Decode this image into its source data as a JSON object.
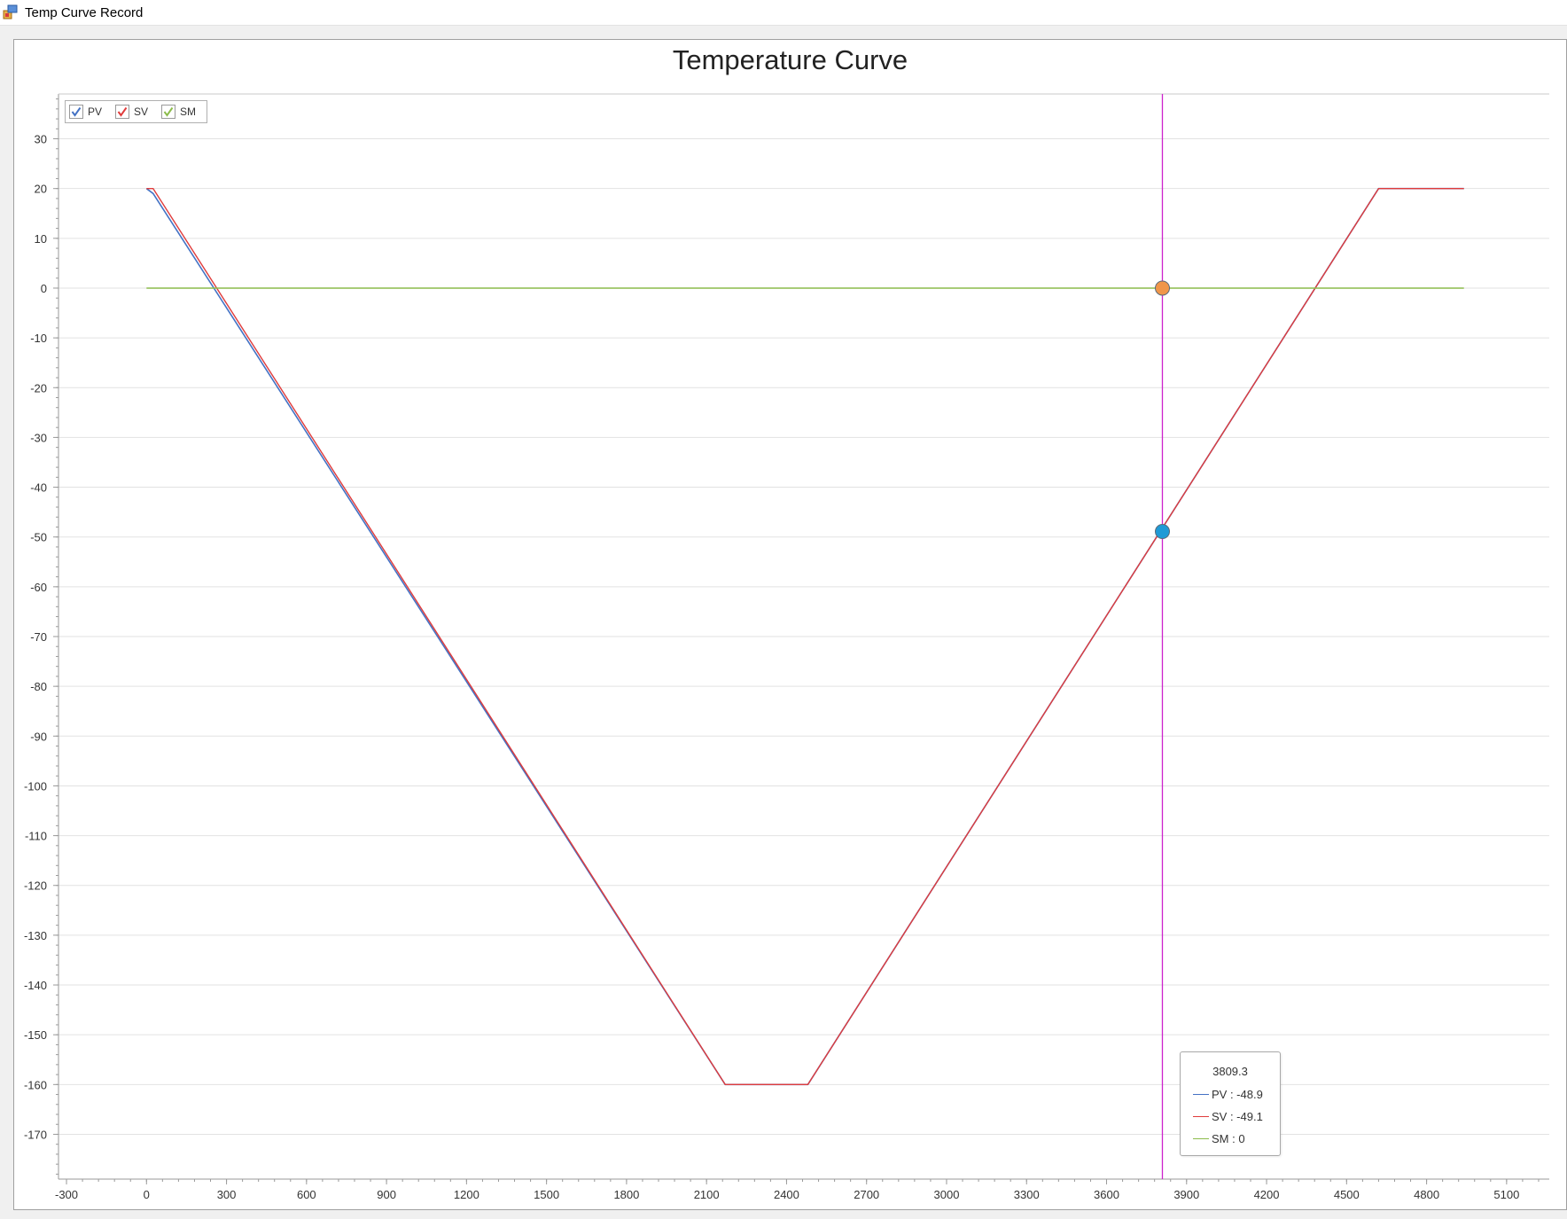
{
  "window": {
    "title": "Temp Curve Record",
    "icon": "chart-app-icon"
  },
  "chart_title": "Temperature Curve",
  "legend": [
    {
      "label": "PV",
      "checked": true,
      "color": "#4472c4"
    },
    {
      "label": "SV",
      "checked": true,
      "color": "#e03c3c"
    },
    {
      "label": "SM",
      "checked": true,
      "color": "#8cbc4c"
    }
  ],
  "crosshair": {
    "x": 3809.3,
    "color": "#cc22cc"
  },
  "tooltip": {
    "x_label": "3809.3",
    "rows": [
      {
        "text": "PV : -48.9",
        "color": "#4472c4"
      },
      {
        "text": "SV : -49.1",
        "color": "#e03c3c"
      },
      {
        "text": "SM : 0",
        "color": "#8cbc4c"
      }
    ]
  },
  "markers": [
    {
      "series": "SM",
      "x": 3809.3,
      "y": 0,
      "color": "#f0964a"
    },
    {
      "series": "PV",
      "x": 3809.3,
      "y": -48.9,
      "color": "#1f9ad6"
    }
  ],
  "chart_data": {
    "type": "line",
    "title": "Temperature Curve",
    "xlabel": "",
    "ylabel": "",
    "xlim": [
      -330,
      5260
    ],
    "ylim": [
      -179,
      39
    ],
    "x_ticks": [
      -300,
      0,
      300,
      600,
      900,
      1200,
      1500,
      1800,
      2100,
      2400,
      2700,
      3000,
      3300,
      3600,
      3900,
      4200,
      4500,
      4800,
      5100
    ],
    "y_ticks": [
      30,
      20,
      10,
      0,
      -10,
      -20,
      -30,
      -40,
      -50,
      -60,
      -70,
      -80,
      -90,
      -100,
      -110,
      -120,
      -130,
      -140,
      -150,
      -160,
      -170
    ],
    "grid": "horizontal",
    "legend_position": "top-left",
    "series": [
      {
        "name": "PV",
        "color": "#4472c4",
        "x": [
          0,
          25,
          2170,
          2480,
          4620,
          4940
        ],
        "y": [
          20,
          19,
          -160,
          -160,
          20,
          20
        ]
      },
      {
        "name": "SV",
        "color": "#e03c3c",
        "x": [
          0,
          25,
          2170,
          2480,
          4620,
          4940
        ],
        "y": [
          20,
          20,
          -160,
          -160,
          20,
          20
        ]
      },
      {
        "name": "SM",
        "color": "#8cbc4c",
        "x": [
          0,
          4940
        ],
        "y": [
          0,
          0
        ]
      }
    ]
  }
}
